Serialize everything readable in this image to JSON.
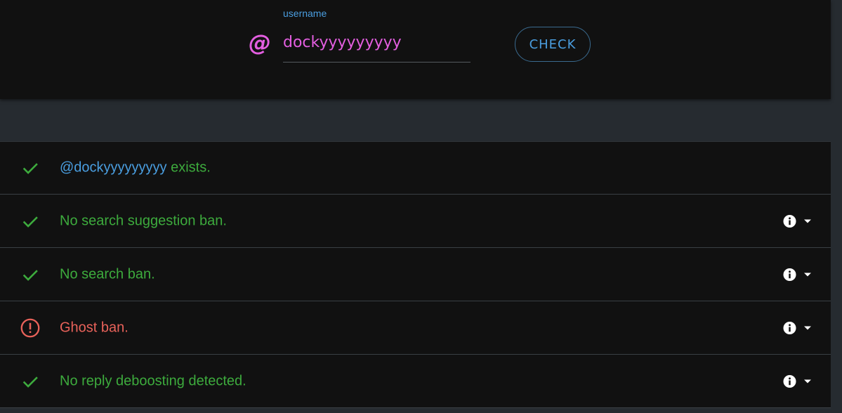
{
  "search": {
    "label": "username",
    "at_symbol": "@",
    "value": "dockyyyyyyyyy",
    "check_label": "CHECK"
  },
  "results": [
    {
      "status": "ok",
      "icon": "check-icon",
      "handle": "@dockyyyyyyyyy",
      "text": " exists.",
      "has_details": false
    },
    {
      "status": "ok",
      "icon": "check-icon",
      "text": "No search suggestion ban.",
      "has_details": true
    },
    {
      "status": "ok",
      "icon": "check-icon",
      "text": "No search ban.",
      "has_details": true
    },
    {
      "status": "ban",
      "icon": "alert-circle-icon",
      "text": "Ghost ban.",
      "has_details": true
    },
    {
      "status": "ok",
      "icon": "check-icon",
      "text": "No reply deboosting detected.",
      "has_details": true
    }
  ],
  "colors": {
    "ok": "#3dab3d",
    "ban": "#e8625a",
    "accent": "#4a9ee0",
    "handle": "#e35ee0"
  }
}
